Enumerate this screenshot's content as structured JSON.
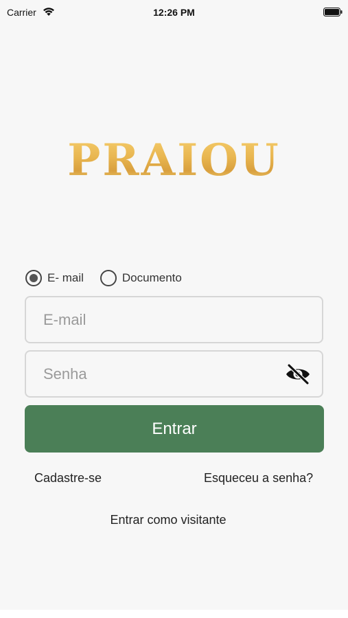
{
  "status_bar": {
    "carrier": "Carrier",
    "time": "12:26 PM",
    "wifi_icon": "wifi-icon",
    "battery_icon": "battery-icon"
  },
  "logo": {
    "text": "PRAIOU",
    "color": "#e8b54f"
  },
  "login_type": {
    "options": [
      {
        "label": "E- mail",
        "selected": true
      },
      {
        "label": "Documento",
        "selected": false
      }
    ]
  },
  "email_field": {
    "placeholder": "E-mail",
    "value": ""
  },
  "password_field": {
    "placeholder": "Senha",
    "value": "",
    "toggle_icon": "eye-off-icon"
  },
  "login_button": {
    "label": "Entrar",
    "color": "#4b7f57"
  },
  "links": {
    "register": "Cadastre-se",
    "forgot_password": "Esqueceu a senha?",
    "guest": "Entrar como visitante"
  }
}
